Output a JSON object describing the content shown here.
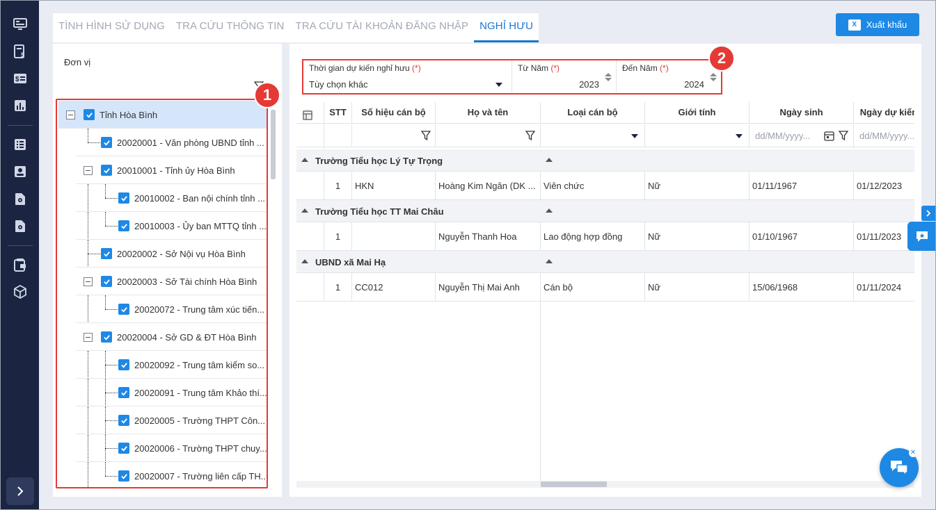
{
  "sidebar": {
    "icons": [
      "monitor-icon",
      "finance-doc-icon",
      "money-card-icon",
      "bar-chart-icon",
      "list-icon",
      "profile-icon",
      "doc-settings-icon",
      "doc-settings-2-icon",
      "wallet-icon",
      "cube-icon"
    ],
    "expand_icon": "chevron-right-icon"
  },
  "tabs": [
    {
      "label": "TÌNH HÌNH SỬ DỤNG",
      "active": false
    },
    {
      "label": "TRA CỨU THÔNG TIN",
      "active": false
    },
    {
      "label": "TRA CỨU TÀI KHOẢN ĐĂNG NHẬP",
      "active": false
    },
    {
      "label": "NGHỈ HƯU",
      "active": true
    }
  ],
  "export_button": {
    "label": "Xuất khẩu",
    "icon": "excel-icon",
    "icon_text": "X"
  },
  "unit_panel": {
    "title": "Đơn vị",
    "tree": [
      {
        "label": "Tỉnh Hòa Bình",
        "checked": true,
        "expanded": true
      },
      {
        "label": "20020001 - Văn phòng UBND tỉnh ...",
        "checked": true
      },
      {
        "label": "20010001 - Tỉnh ủy Hòa Bình",
        "checked": true,
        "expanded": true
      },
      {
        "label": "20010002 - Ban nội chính tỉnh ...",
        "checked": true
      },
      {
        "label": "20010003 - Ủy ban MTTQ tỉnh ...",
        "checked": true
      },
      {
        "label": "20020002 - Sở Nội vụ Hòa Bình",
        "checked": true
      },
      {
        "label": "20020003 - Sở Tài chính Hòa Bình",
        "checked": true,
        "expanded": true
      },
      {
        "label": "20020072 - Trung tâm xúc tiến...",
        "checked": true
      },
      {
        "label": "20020004 - Sở GD & ĐT Hòa Bình",
        "checked": true,
        "expanded": true
      },
      {
        "label": "20020092 - Trung tâm kiểm so...",
        "checked": true
      },
      {
        "label": "20020091 - Trung tâm Khảo thí...",
        "checked": true
      },
      {
        "label": "20020005 - Trường THPT Côn...",
        "checked": true
      },
      {
        "label": "20020006 - Trường THPT chuy...",
        "checked": true
      },
      {
        "label": "20020007 - Trường liên cấp TH...",
        "checked": true
      }
    ]
  },
  "filters": {
    "period": {
      "label": "Thời gian dự kiến nghỉ hưu",
      "required": "(*)",
      "value": "Tùy chọn khác"
    },
    "from_year": {
      "label": "Từ Năm",
      "required": "(*)",
      "value": "2023"
    },
    "to_year": {
      "label": "Đến Năm",
      "required": "(*)",
      "value": "2024"
    }
  },
  "markers": [
    "1",
    "2"
  ],
  "grid": {
    "columns": [
      "STT",
      "Số hiệu cán bộ",
      "Họ và tên",
      "Loại cán bộ",
      "Giới tính",
      "Ngày sinh",
      "Ngày dự kiến"
    ],
    "date_placeholder": "dd/MM/yyyy...",
    "groups": [
      {
        "name": "Trường Tiểu học Lý Tự Trọng",
        "rows": [
          {
            "stt": "1",
            "code": "HKN",
            "name": "Hoàng Kim Ngân (DK ...",
            "type": "Viên chức",
            "gender": "Nữ",
            "dob": "01/11/1967",
            "retire": "01/12/2023"
          }
        ]
      },
      {
        "name": "Trường Tiểu học TT Mai Châu",
        "rows": [
          {
            "stt": "1",
            "code": "",
            "name": "Nguyễn Thanh Hoa",
            "type": "Lao động hợp đồng",
            "gender": "Nữ",
            "dob": "01/10/1967",
            "retire": "01/11/2023"
          }
        ]
      },
      {
        "name": "UBND xã Mai Hạ",
        "rows": [
          {
            "stt": "1",
            "code": "CC012",
            "name": "Nguyễn Thị Mai Anh",
            "type": "Cán bộ",
            "gender": "Nữ",
            "dob": "15/06/1968",
            "retire": "01/11/2024"
          }
        ]
      }
    ]
  },
  "colors": {
    "accent": "#1e88e5",
    "sidebar": "#1b2440",
    "marker": "#e53935",
    "tab_active": "#1976d2"
  }
}
